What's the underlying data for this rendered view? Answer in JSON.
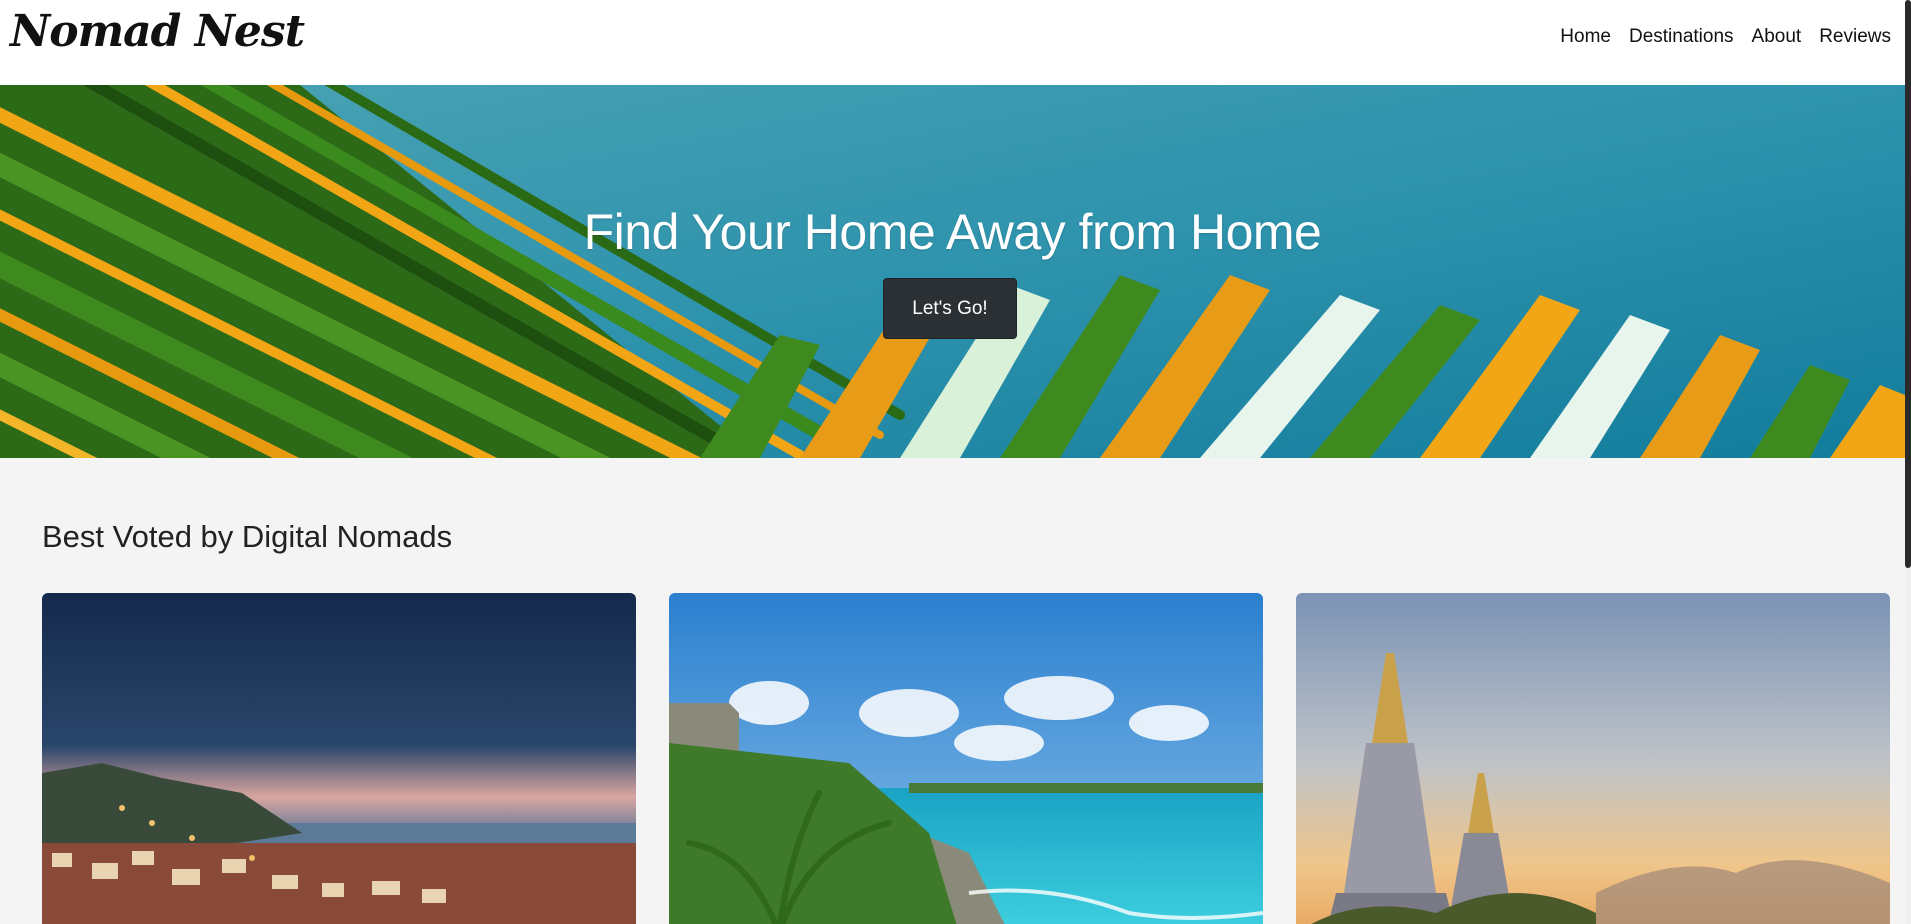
{
  "header": {
    "brand": "Nomad Nest",
    "nav": [
      "Home",
      "Destinations",
      "About",
      "Reviews"
    ]
  },
  "hero": {
    "title": "Find Your Home Away from Home",
    "button_label": "Let's Go!"
  },
  "section": {
    "title": "Best Voted by Digital Nomads"
  },
  "colors": {
    "button": "#2b3035",
    "background": "#f4f4f4"
  }
}
